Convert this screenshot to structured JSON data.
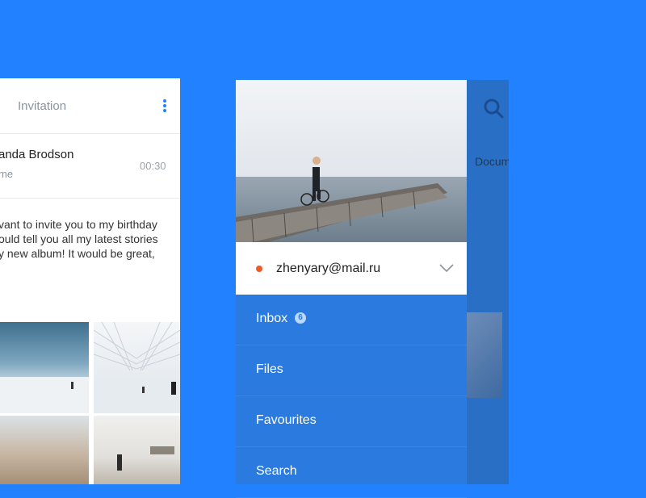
{
  "background_color": "#2181ff",
  "email_card": {
    "title": "Invitation",
    "more_icon": "more-vertical-icon",
    "sender_name": "anda Brodson",
    "sender_subtitle": "me",
    "time": "00:30",
    "body_lines": [
      "vant to invite you to my birthday",
      "ould tell you all my latest stories",
      "y new album! It would be great,"
    ]
  },
  "background_panel": {
    "search_icon": "search-icon",
    "documents_label": "Docum"
  },
  "drawer": {
    "account": {
      "email": "zhenyary@mail.ru",
      "status_color": "#f05a24",
      "expand_icon": "chevron-down-icon"
    },
    "menu": [
      {
        "label": "Inbox",
        "badge": "6"
      },
      {
        "label": "Files",
        "badge": ""
      },
      {
        "label": "Favourites",
        "badge": ""
      },
      {
        "label": "Search",
        "badge": ""
      }
    ],
    "accent_color": "#2a7ae0"
  }
}
